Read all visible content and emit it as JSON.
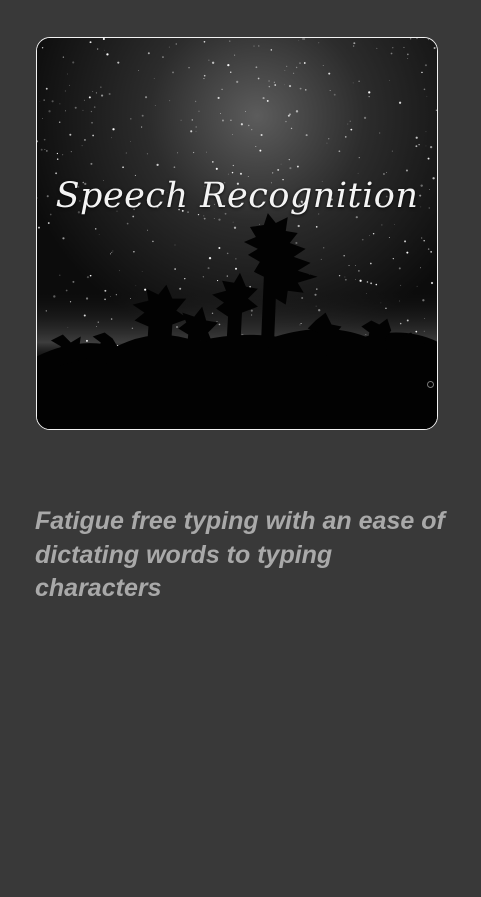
{
  "hero": {
    "title": "Speech Recognition",
    "background_icon": "night-sky-trees-image",
    "border_color": "#f2f2f2"
  },
  "description": {
    "text": "Fatigue free typing with an ease of dictating words to typing characters",
    "color": "#a9a9a9"
  },
  "page": {
    "background_color": "#393939"
  }
}
